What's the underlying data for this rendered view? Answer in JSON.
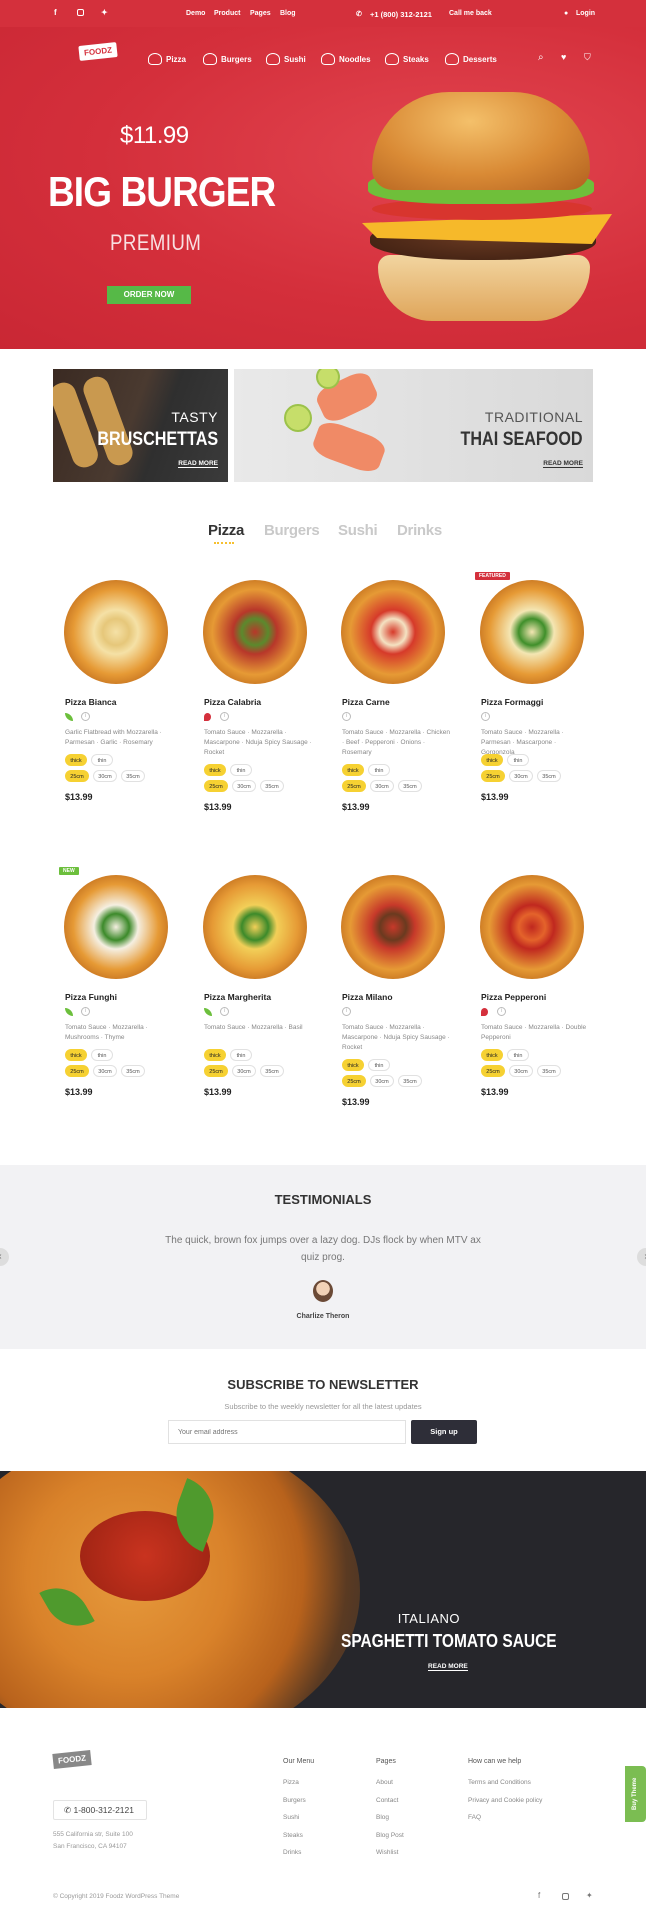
{
  "topbar": {
    "nav": [
      "Demo",
      "Product",
      "Pages",
      "Blog"
    ],
    "phone": "+1 (800) 312-2121",
    "callback": "Call me back",
    "login": "Login"
  },
  "brand": {
    "logo": "FOODZ"
  },
  "mainnav": [
    "Pizza",
    "Burgers",
    "Sushi",
    "Noodles",
    "Steaks",
    "Desserts"
  ],
  "hero": {
    "price": "$11.99",
    "title": "BIG BURGER",
    "subtitle": "PREMIUM",
    "cta": "ORDER NOW"
  },
  "banners": [
    {
      "small": "TASTY",
      "big": "BRUSCHETTAS",
      "link": "READ MORE"
    },
    {
      "small": "TRADITIONAL",
      "big": "THAI SEAFOOD",
      "link": "READ MORE"
    }
  ],
  "tabs": [
    "Pizza",
    "Burgers",
    "Sushi",
    "Drinks"
  ],
  "products": [
    {
      "name": "Pizza Bianca",
      "ingredients": "Garlic Flatbread with Mozzarella · Parmesan · Garlic · Rosemary",
      "price": "$13.99",
      "badge": "",
      "veg": true,
      "spicy": false,
      "crust": [
        "thick",
        "thin"
      ],
      "sizes": [
        "25cm",
        "30cm",
        "35cm"
      ]
    },
    {
      "name": "Pizza Calabria",
      "ingredients": "Tomato Sauce · Mozzarella · Mascarpone · Nduja Spicy Sausage · Rocket",
      "price": "$13.99",
      "badge": "",
      "veg": false,
      "spicy": true,
      "crust": [
        "thick",
        "thin"
      ],
      "sizes": [
        "25cm",
        "30cm",
        "35cm"
      ]
    },
    {
      "name": "Pizza Carne",
      "ingredients": "Tomato Sauce · Mozzarella · Chicken · Beef · Pepperoni · Onions · Rosemary",
      "price": "$13.99",
      "badge": "",
      "veg": false,
      "spicy": false,
      "crust": [
        "thick",
        "thin"
      ],
      "sizes": [
        "25cm",
        "30cm",
        "35cm"
      ]
    },
    {
      "name": "Pizza Formaggi",
      "ingredients": "Tomato Sauce · Mozzarella · Parmesan · Mascarpone · Gorgonzola",
      "price": "$13.99",
      "badge": "FEATURED",
      "veg": false,
      "spicy": false,
      "crust": [
        "thick",
        "thin"
      ],
      "sizes": [
        "25cm",
        "30cm",
        "35cm"
      ]
    },
    {
      "name": "Pizza Funghi",
      "ingredients": "Tomato Sauce · Mozzarella · Mushrooms · Thyme",
      "price": "$13.99",
      "badge": "NEW",
      "veg": true,
      "spicy": false,
      "crust": [
        "thick",
        "thin"
      ],
      "sizes": [
        "25cm",
        "30cm",
        "35cm"
      ]
    },
    {
      "name": "Pizza Margherita",
      "ingredients": "Tomato Sauce · Mozzarella · Basil",
      "price": "$13.99",
      "badge": "",
      "veg": true,
      "spicy": false,
      "crust": [
        "thick",
        "thin"
      ],
      "sizes": [
        "25cm",
        "30cm",
        "35cm"
      ]
    },
    {
      "name": "Pizza Milano",
      "ingredients": "Tomato Sauce · Mozzarella · Mascarpone · Nduja Spicy Sausage · Rocket",
      "price": "$13.99",
      "badge": "",
      "veg": false,
      "spicy": false,
      "crust": [
        "thick",
        "thin"
      ],
      "sizes": [
        "25cm",
        "30cm",
        "35cm"
      ]
    },
    {
      "name": "Pizza Pepperoni",
      "ingredients": "Tomato Sauce · Mozzarella · Double Pepperoni",
      "price": "$13.99",
      "badge": "",
      "veg": false,
      "spicy": true,
      "crust": [
        "thick",
        "thin"
      ],
      "sizes": [
        "25cm",
        "30cm",
        "35cm"
      ]
    }
  ],
  "testimonials": {
    "heading": "TESTIMONIALS",
    "quote": "The quick, brown fox jumps over a lazy dog. DJs flock by when MTV ax quiz prog.",
    "author": "Charlize Theron"
  },
  "newsletter": {
    "heading": "SUBSCRIBE TO NEWSLETTER",
    "sub": "Subscribe to the weekly newsletter for all the latest updates",
    "placeholder": "Your email address",
    "button": "Sign up"
  },
  "pasta": {
    "small": "ITALIANO",
    "big": "SPAGHETTI TOMATO SAUCE",
    "link": "READ MORE"
  },
  "footer": {
    "phone": "1-800-312-2121",
    "address1": "555 California str, Suite 100",
    "address2": "San Francisco, CA 94107",
    "cols": [
      {
        "title": "Our Menu",
        "links": [
          "Pizza",
          "Burgers",
          "Sushi",
          "Steaks",
          "Drinks"
        ]
      },
      {
        "title": "Pages",
        "links": [
          "About",
          "Contact",
          "Blog",
          "Blog Post",
          "Wishlist"
        ]
      },
      {
        "title": "How can we help",
        "links": [
          "Terms and Conditions",
          "Privacy and Cookie policy",
          "FAQ"
        ]
      }
    ],
    "copyright": "© Copyright 2019 Foodz WordPress Theme",
    "buy": "Buy Theme"
  },
  "colors": {
    "brand_red": "#d4303c",
    "order_green": "#56b947",
    "chip_yellow": "#f6d132",
    "dark": "#2e2e38"
  },
  "icons": [
    "facebook-icon",
    "instagram-icon",
    "twitter-icon",
    "phone-icon",
    "user-icon",
    "search-icon",
    "heart-icon",
    "cart-icon",
    "leaf-icon",
    "pepper-icon",
    "info-icon"
  ]
}
